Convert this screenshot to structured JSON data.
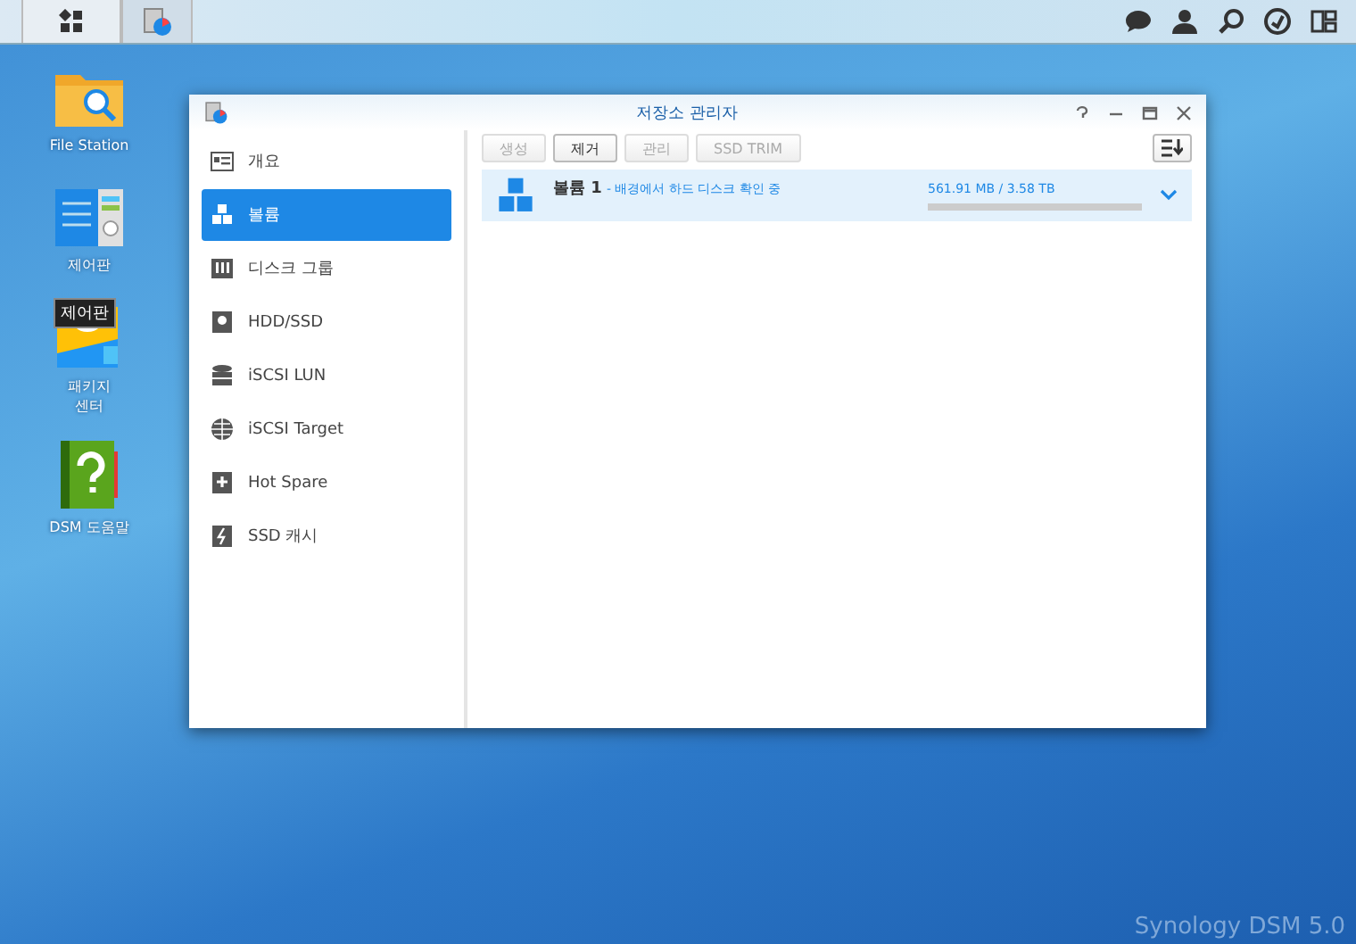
{
  "taskbar": {
    "apps": [
      {
        "kind": "main-menu",
        "selected": false
      },
      {
        "kind": "storage",
        "selected": true
      }
    ]
  },
  "desktop": {
    "icons": [
      {
        "label": "File Station",
        "kind": "folder"
      },
      {
        "label": "제어판",
        "kind": "control"
      },
      {
        "label": "패키지\n센터",
        "kind": "package",
        "tooltip": "제어판"
      },
      {
        "label": "DSM 도움말",
        "kind": "help"
      }
    ],
    "wallpaper_logo": "Synology DSM 5.0"
  },
  "window": {
    "title": "저장소 관리자",
    "sidebar": {
      "items": [
        {
          "label": "개요",
          "selected": false
        },
        {
          "label": "볼륨",
          "selected": true
        },
        {
          "label": "디스크 그룹",
          "selected": false
        },
        {
          "label": "HDD/SSD",
          "selected": false
        },
        {
          "label": "iSCSI LUN",
          "selected": false
        },
        {
          "label": "iSCSI Target",
          "selected": false
        },
        {
          "label": "Hot Spare",
          "selected": false
        },
        {
          "label": "SSD 캐시",
          "selected": false
        }
      ]
    },
    "toolbar": {
      "buttons": [
        {
          "label": "생성",
          "disabled": true
        },
        {
          "label": "제거",
          "disabled": false
        },
        {
          "label": "관리",
          "disabled": true
        },
        {
          "label": "SSD TRIM",
          "disabled": true
        }
      ]
    },
    "volumes": [
      {
        "name": "볼륨 1",
        "status": "- 배경에서 하드 디스크 확인 중",
        "usage": "561.91 MB / 3.58 TB",
        "level": 0.0,
        "expanded": false
      }
    ]
  }
}
